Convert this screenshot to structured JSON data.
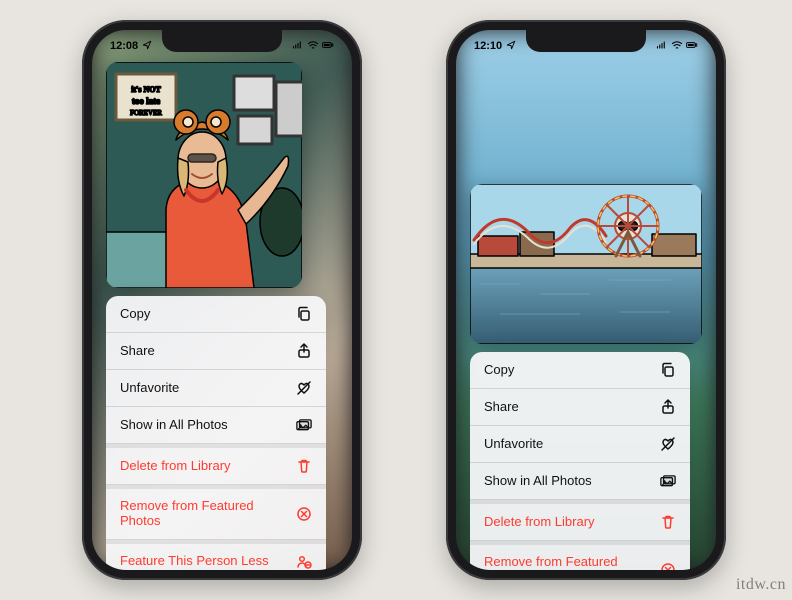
{
  "watermark": "itdw.cn",
  "phones": {
    "left": {
      "status": {
        "time": "12:08",
        "loc_icon": "location",
        "signal": "signal",
        "wifi": "wifi",
        "battery": "battery"
      },
      "menu": [
        {
          "label": "Copy",
          "icon": "copy",
          "destructive": false,
          "sep": false
        },
        {
          "label": "Share",
          "icon": "share",
          "destructive": false,
          "sep": false
        },
        {
          "label": "Unfavorite",
          "icon": "heart-slash",
          "destructive": false,
          "sep": false
        },
        {
          "label": "Show in All Photos",
          "icon": "photo-stack",
          "destructive": false,
          "sep": false
        },
        {
          "label": "Delete from Library",
          "icon": "trash",
          "destructive": true,
          "sep": true
        },
        {
          "label": "Remove from Featured Photos",
          "icon": "circle-x",
          "destructive": true,
          "sep": true
        },
        {
          "label": "Feature This Person Less",
          "icon": "person-minus",
          "destructive": true,
          "sep": true
        }
      ]
    },
    "right": {
      "status": {
        "time": "12:10",
        "loc_icon": "location",
        "signal": "signal",
        "wifi": "wifi",
        "battery": "battery"
      },
      "menu": [
        {
          "label": "Copy",
          "icon": "copy",
          "destructive": false,
          "sep": false
        },
        {
          "label": "Share",
          "icon": "share",
          "destructive": false,
          "sep": false
        },
        {
          "label": "Unfavorite",
          "icon": "heart-slash",
          "destructive": false,
          "sep": false
        },
        {
          "label": "Show in All Photos",
          "icon": "photo-stack",
          "destructive": false,
          "sep": false
        },
        {
          "label": "Delete from Library",
          "icon": "trash",
          "destructive": true,
          "sep": true
        },
        {
          "label": "Remove from Featured Photos",
          "icon": "circle-x",
          "destructive": true,
          "sep": true
        }
      ]
    }
  }
}
